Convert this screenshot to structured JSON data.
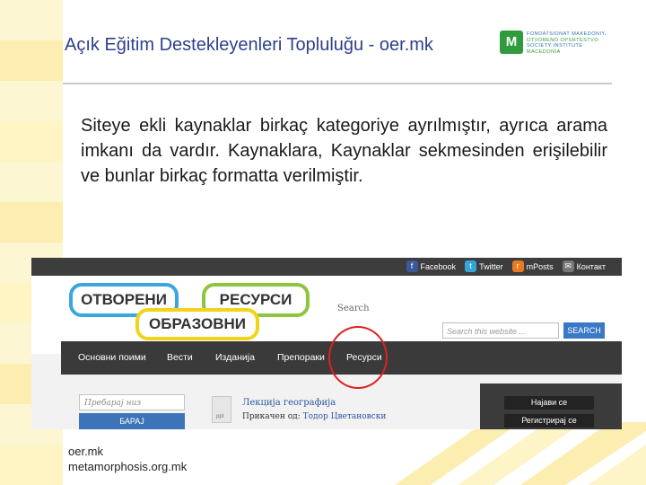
{
  "slide": {
    "title": "Açık Eğitim Destekleyenleri Topluluğu - oer.mk",
    "body": "Siteye ekli kaynaklar birkaç kategoriye ayrılmıştır, ayrıca arama imkanı da vardır. Kaynaklara, Kaynaklar sekmesinden erişilebilir ve bunlar birkaç formatta verilmiştir.",
    "footer_line1": "oer.mk",
    "footer_line2": "metamorphosis.org.mk"
  },
  "logo": {
    "mark": "M",
    "lines": [
      "FONDATSIONAT MAKEDONIYA",
      "OTVORENO OPSHTESTVO",
      "SOCIETY INSTITUTE",
      "MACEDONIA"
    ]
  },
  "website": {
    "social_links": [
      {
        "label": "Facebook",
        "icon": "facebook-icon",
        "glyph": "f"
      },
      {
        "label": "Twitter",
        "icon": "twitter-icon",
        "glyph": "t"
      },
      {
        "label": "mPosts",
        "icon": "rss-icon",
        "glyph": "r"
      },
      {
        "label": "Контакт",
        "icon": "mail-icon",
        "glyph": "✉"
      }
    ],
    "logo_words": [
      "ОТВОРЕНИ",
      "РЕСУРСИ",
      "ОБРАЗОВНИ"
    ],
    "search_label": "Search",
    "search_placeholder": "Search this website ...",
    "search_button": "SEARCH",
    "nav_items": [
      "Основни поими",
      "Вести",
      "Изданија",
      "Препораки",
      "Ресурси"
    ],
    "sidebar_search_placeholder": "Пребарај низ ресурсите",
    "sidebar_search_button": "БАРАЈ",
    "document": {
      "icon_tag": "ppt",
      "title": "Лекција географија",
      "meta_label": "Прикачен од:",
      "author": "Тодор Цветановски"
    },
    "account_buttons": [
      "Најави се",
      "Регистрирај се"
    ]
  },
  "colors": {
    "title_blue": "#2e3f8c",
    "nav_dark": "#3a3a3a",
    "highlight_red": "#e02020",
    "pill_blue": "#3aa6e0",
    "pill_green": "#8cc63f",
    "pill_yellow": "#f2d31b"
  }
}
